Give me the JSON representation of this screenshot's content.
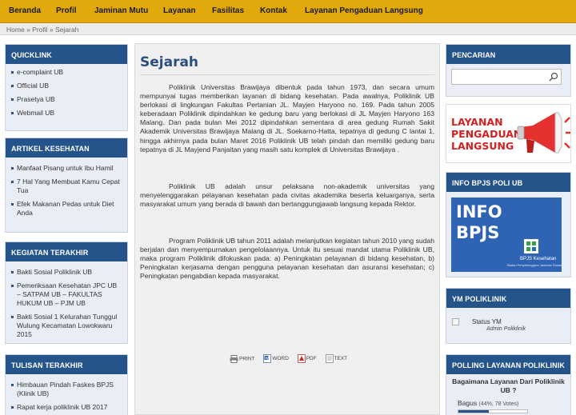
{
  "nav": {
    "items": [
      "Beranda",
      "Profil",
      "Jaminan Mutu",
      "Layanan",
      "Fasilitas",
      "Kontak",
      "Layanan Pengaduan Langsung"
    ]
  },
  "breadcrumb": [
    "Home",
    "Profil",
    "Sejarah"
  ],
  "left": {
    "quicklink": {
      "title": "QUICKLINK",
      "items": [
        "e-complaint UB",
        "Official UB",
        "Prasetya UB",
        "Webmail UB"
      ]
    },
    "artikel": {
      "title": "ARTIKEL KESEHATAN",
      "items": [
        "Manfaat Pisang untuk Ibu Hamil",
        "7 Hal Yang Membuat Kamu Cepat Tua",
        "Efek Makanan Pedas untuk Diet Anda"
      ]
    },
    "kegiatan": {
      "title": "KEGIATAN TERAKHIR",
      "items": [
        "Bakti Sosial Poliklinik UB",
        "Pemeriksaan Kesehatan JPC UB – SATPAM UB – FAKULTAS HUKUM UB – PJM UB",
        "Bakti Sosial 1 Kelurahan Tunggul Wulung Kecamatan Lowokwaru 2015"
      ]
    },
    "tulisan": {
      "title": "TULISAN TERAKHIR",
      "items": [
        "Himbauan Pindah Faskes BPJS (Klinik UB)",
        "Rapat kerja poliklinik UB 2017"
      ]
    }
  },
  "main": {
    "title": "Sejarah",
    "paragraphs": [
      "Poliklinik Universitas Brawijaya dibentuk pada tahun 1973, dan secara umum mempunyai tugas memberikan layanan di bidang kesehatan. Pada awalnya, Poliklinik UB berlokasi di lingkungan Fakultas Pertanian JL. Mayjen Haryono no. 169. Pada tahun 2005 keberadaan Poliklinik dipindahkan ke gedung baru yang berlokasi di JL Mayjen Haryono 163 Malang. Dan pada bulan Mei 2012 dipindahkan sementara di area gedung Rumah Sakit Akademik Universitas Brawijaya Malang di JL. Soekarno-Hatta, tepatnya di gedung C lantai 1, hingga akhirnya pada bulan Maret 2016 Poliklinik UB telah pindah dan memiliki gedung baru tepatnya di JL Mayjend Panjaitan yang masih satu komplek di Universitas Brawijaya .",
      "Poliklinik UB adalah unsur pelaksana non-akademik universitas yang menyelenggarakan pelayanan kesehatan pada civitas akademika beserta keluarganya, serta masyarakat umum yang berada di bawah dan bertanggungjawab langsung kepada Rektor.",
      "Program Poliklinik UB tahun 2011 adalah melanjutkan kegiatan tahun 2010 yang sudah berjalan dan menyempurnakan pengelolaannya. Untuk itu sesuai mandat utama Poliklinik UB, maka program Poliklinik difokuskan pada: a) Peningkatan pelayanan di bidang kesehatan, b) Peningkatan kerjasama dengan pengguna pelayanan kesehatan dan asuransi kesehatan; c) Peningkatan pengabdian kepada masyarakat."
    ],
    "tools": [
      "PRINT",
      "WORD",
      "PDF",
      "TEXT"
    ]
  },
  "right": {
    "search": {
      "title": "PENCARIAN",
      "value": ""
    },
    "layanan_banner": {
      "lines": [
        "LAYANAN",
        "PENGADUAN",
        "LANGSUNG"
      ]
    },
    "bpjs": {
      "title": "INFO BPJS POLI UB",
      "banner_lines": [
        "INFO",
        "BPJS"
      ],
      "logo_text": "BPJS Kesehatan",
      "logo_subtext": "Badan Penyelenggara Jaminan Sosial"
    },
    "ym": {
      "title": "YM POLIKLINIK",
      "status": "Status YM",
      "sub": "Admin Poliklinik"
    },
    "polling": {
      "title": "POLLING LAYANAN POLIKLINIK",
      "question": "Bagaimana Layanan Dari Poliklinik UB ?",
      "option_label": "Bagus",
      "option_meta": "(44%, 78 Votes)",
      "option_fraction": 0.44
    }
  },
  "colors": {
    "nav_bg": "#e1a90c",
    "box_title_bg": "#24548a",
    "box_bg": "#e9eef6",
    "heading": "#2a4e7e",
    "banner_red": "#d42020",
    "bpjs_blue": "#2f64b4"
  }
}
